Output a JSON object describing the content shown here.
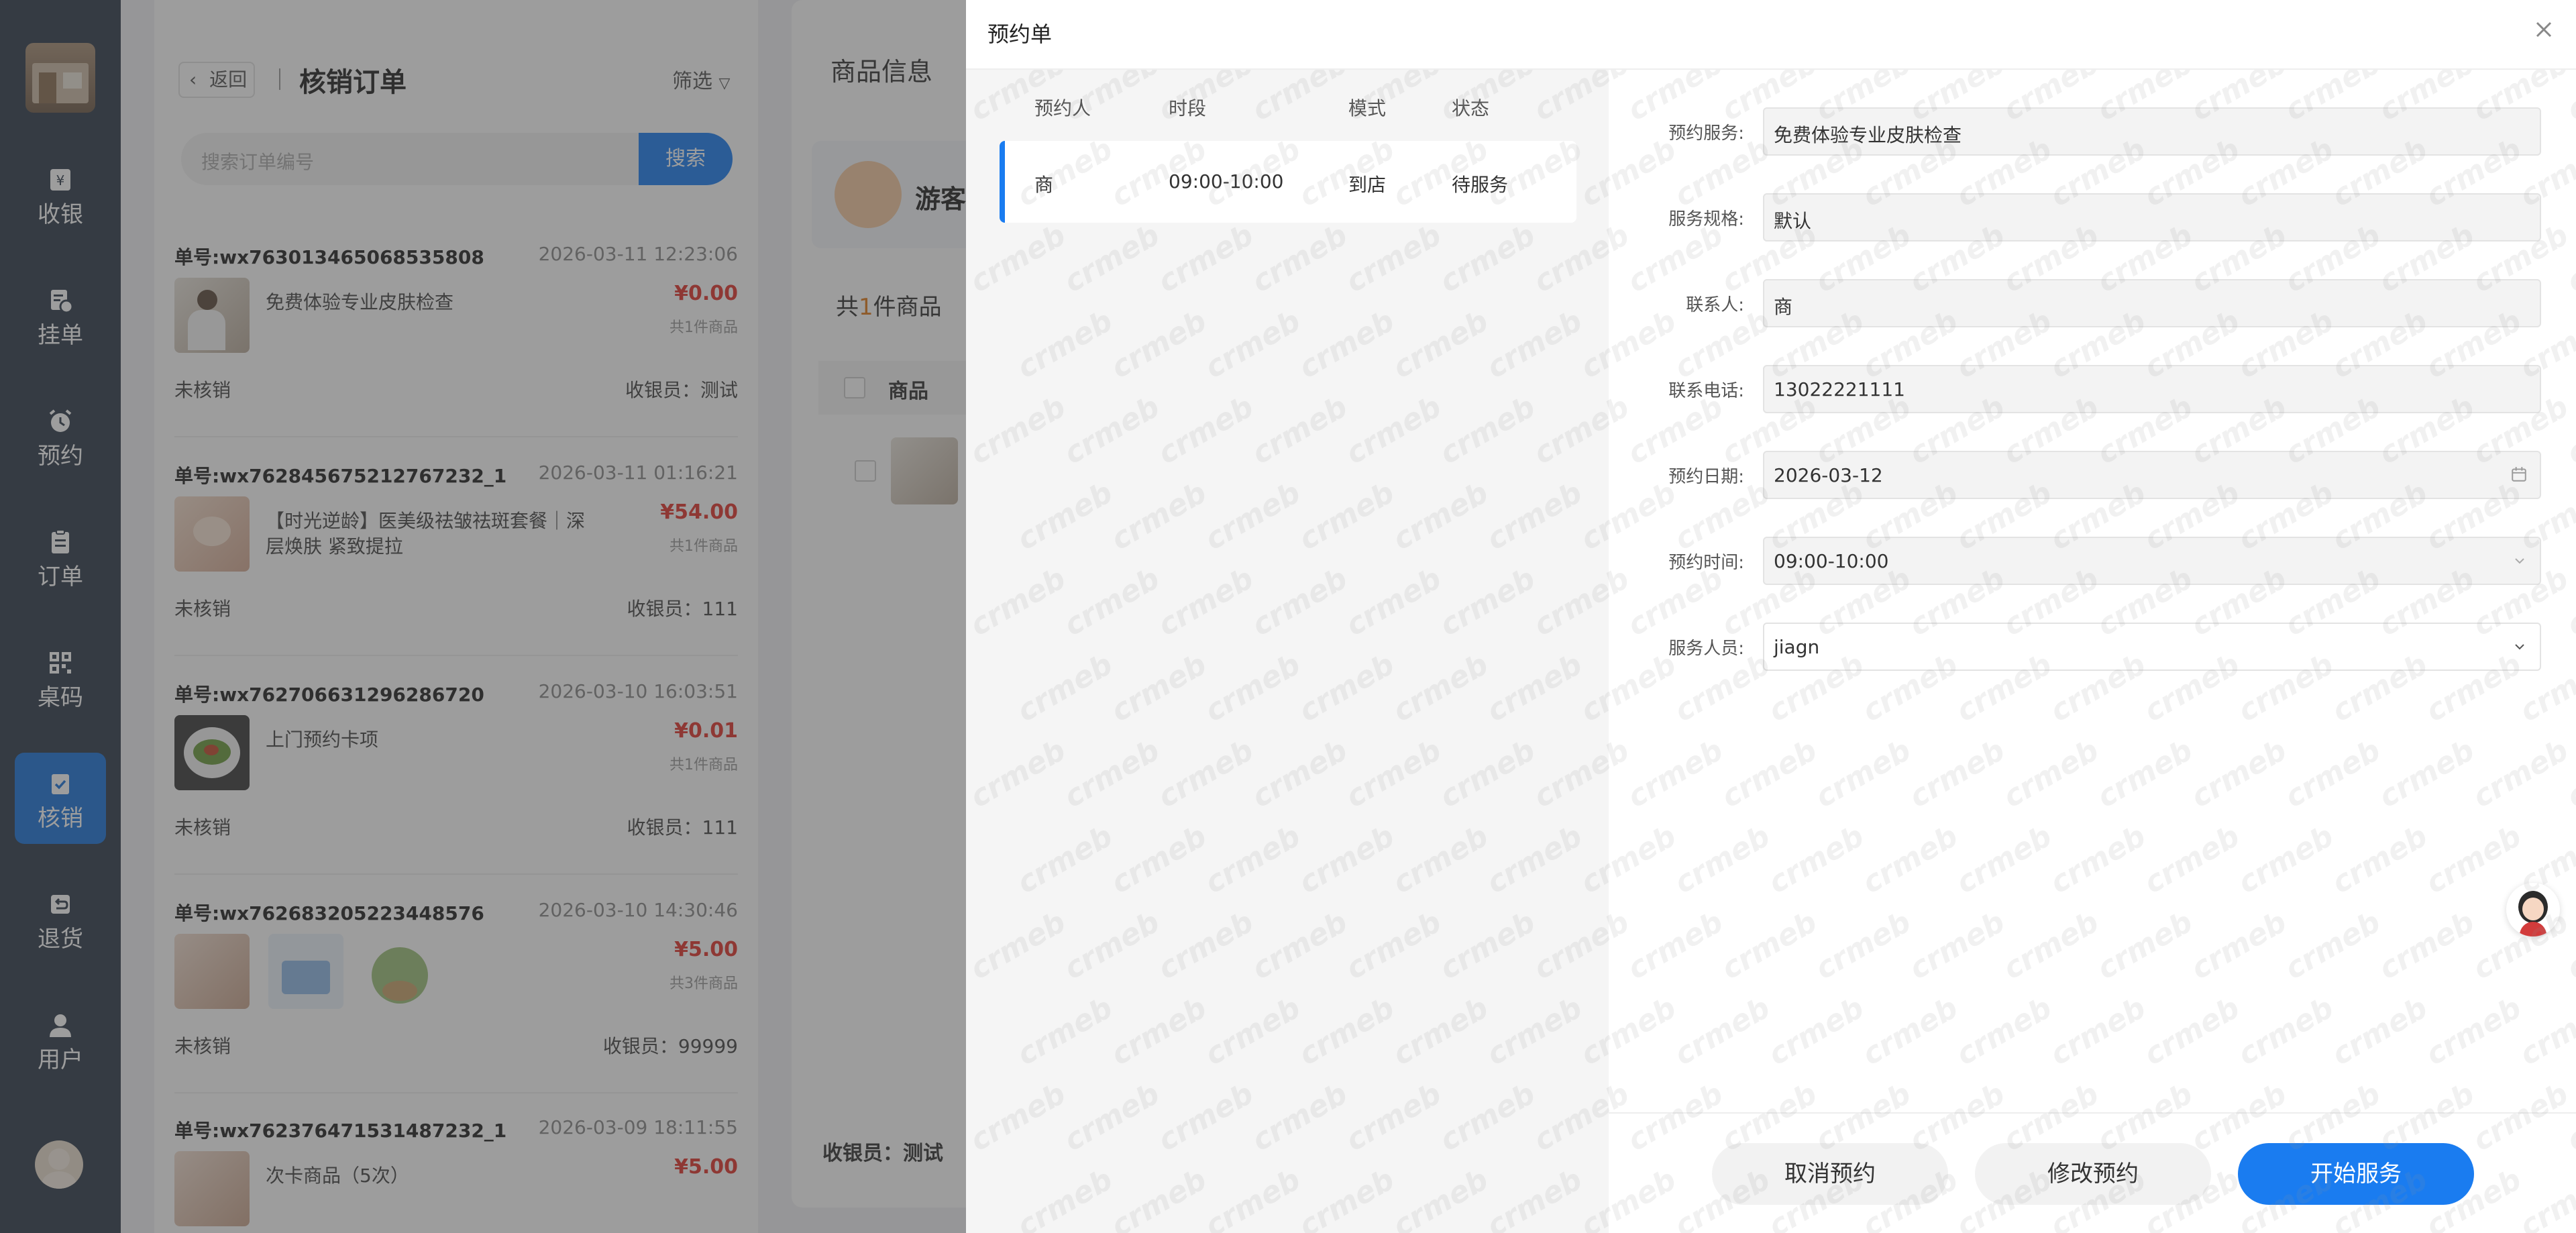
{
  "sidebar": {
    "items": [
      {
        "label": "收银",
        "icon": "yen-icon"
      },
      {
        "label": "挂单",
        "icon": "pending-order-icon"
      },
      {
        "label": "预约",
        "icon": "alarm-clock-icon"
      },
      {
        "label": "订单",
        "icon": "clipboard-icon"
      },
      {
        "label": "桌码",
        "icon": "qr-code-icon"
      },
      {
        "label": "核销",
        "icon": "verify-icon",
        "active": true
      },
      {
        "label": "退货",
        "icon": "return-icon"
      },
      {
        "label": "用户",
        "icon": "user-icon"
      }
    ]
  },
  "order_panel": {
    "back_label": "返回",
    "title": "核销订单",
    "filter_label": "筛选",
    "search_placeholder": "搜索订单编号",
    "search_button": "搜索",
    "orders": [
      {
        "no": "单号:wx763013465068535808",
        "time": "2026-03-11 12:23:06",
        "product": "免费体验专业皮肤检查",
        "price": "¥0.00",
        "count": "共1件商品",
        "status": "未核销",
        "cashier": "收银员：测试"
      },
      {
        "no": "单号:wx762845675212767232_1",
        "time": "2026-03-11 01:16:21",
        "product": "【时光逆龄】医美级祛皱祛斑套餐｜深层焕肤 紧致提拉",
        "price": "¥54.00",
        "count": "共1件商品",
        "status": "未核销",
        "cashier": "收银员：111"
      },
      {
        "no": "单号:wx762706631296286720",
        "time": "2026-03-10 16:03:51",
        "product": "上门预约卡项",
        "price": "¥0.01",
        "count": "共1件商品",
        "status": "未核销",
        "cashier": "收银员：111"
      },
      {
        "no": "单号:wx762683205223448576",
        "time": "2026-03-10 14:30:46",
        "product": "",
        "price": "¥5.00",
        "count": "共3件商品",
        "status": "未核销",
        "cashier": "收银员：99999"
      },
      {
        "no": "单号:wx762376471531487232_1",
        "time": "2026-03-09 18:11:55",
        "product": "次卡商品（5次）",
        "price": "¥5.00",
        "count": "",
        "status": "",
        "cashier": ""
      }
    ]
  },
  "goods_panel": {
    "title": "商品信息",
    "customer_name": "游客",
    "total_prefix": "共",
    "total_num": "1",
    "total_suffix": "件商品",
    "col_goods": "商品",
    "cashier": "收银员：测试"
  },
  "drawer": {
    "title": "预约单",
    "table_headers": [
      "预约人",
      "时段",
      "模式",
      "状态"
    ],
    "row": {
      "person": "商",
      "slot": "09:00-10:00",
      "mode": "到店",
      "status": "待服务"
    },
    "form": {
      "service_label": "预约服务:",
      "service_value": "免费体验专业皮肤检查",
      "spec_label": "服务规格:",
      "spec_value": "默认",
      "contact_label": "联系人:",
      "contact_value": "商",
      "phone_label": "联系电话:",
      "phone_value": "13022221111",
      "date_label": "预约日期:",
      "date_value": "2026-03-12",
      "time_label": "预约时间:",
      "time_value": "09:00-10:00",
      "staff_label": "服务人员:",
      "staff_value": "jiagn"
    },
    "buttons": {
      "cancel": "取消预约",
      "modify": "修改预约",
      "start": "开始服务"
    },
    "watermark_text": "crmeb"
  },
  "colors": {
    "primary": "#1a7cf0",
    "price_red": "#e0342c",
    "sidebar_bg": "#2e3a4a"
  }
}
